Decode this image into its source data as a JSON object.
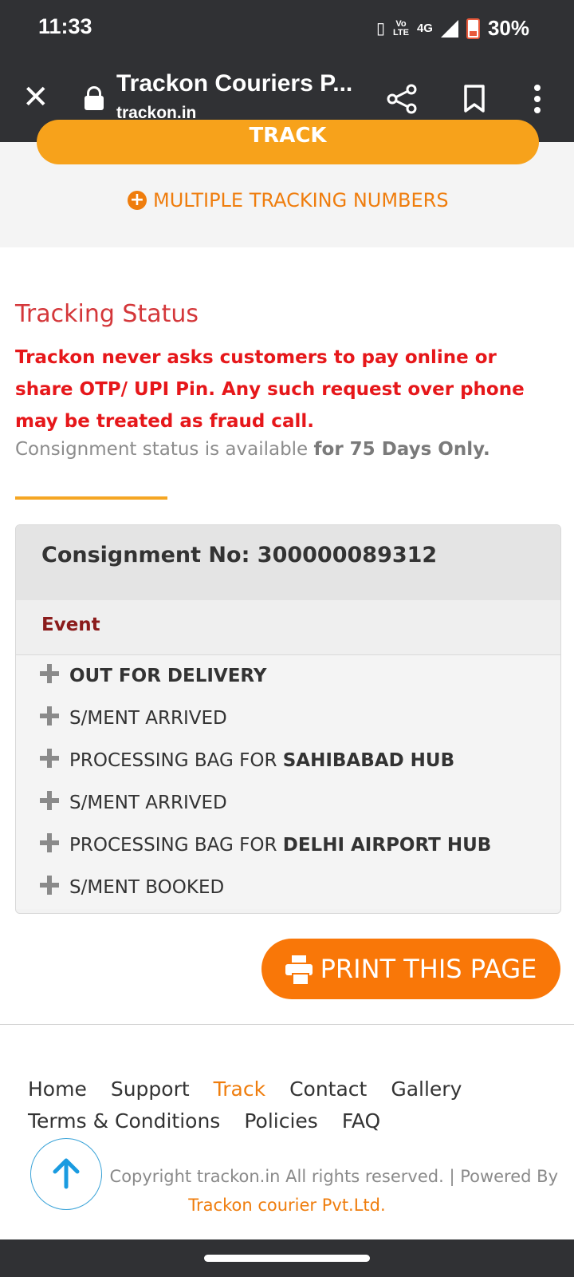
{
  "status_bar": {
    "time": "11:33",
    "network": "4G",
    "volte": "Vo LTE",
    "battery": "30%"
  },
  "browser": {
    "page_title": "Trackon Couriers P...",
    "url": "trackon.in"
  },
  "track_button": "TRACK",
  "multiple_tracking": "MULTIPLE TRACKING NUMBERS",
  "tracking": {
    "title": "Tracking Status",
    "warning": "Trackon never asks customers to pay online or share OTP/ UPI Pin. Any such request over phone may be treated as fraud call.",
    "availability_prefix": "Consignment status is available ",
    "availability_bold": "for 75 Days Only."
  },
  "consignment": {
    "label": "Consignment No: 300000089312",
    "event_header": "Event",
    "events": [
      {
        "text": "",
        "bold": "OUT FOR DELIVERY"
      },
      {
        "text": "S/MENT ARRIVED",
        "bold": ""
      },
      {
        "text": "PROCESSING BAG FOR ",
        "bold": "SAHIBABAD HUB"
      },
      {
        "text": "S/MENT ARRIVED",
        "bold": ""
      },
      {
        "text": "PROCESSING BAG FOR ",
        "bold": "DELHI AIRPORT HUB"
      },
      {
        "text": "S/MENT BOOKED",
        "bold": ""
      }
    ]
  },
  "print_button": "PRINT THIS PAGE",
  "footer": {
    "nav": [
      "Home",
      "Support",
      "Track",
      "Contact",
      "Gallery"
    ],
    "nav2": [
      "Terms & Conditions",
      "Policies",
      "FAQ"
    ],
    "active": "Track",
    "copyright": "© Copyright trackon.in All rights reserved.   |   Powered By",
    "powered_by": "Trackon courier Pvt.Ltd."
  },
  "colors": {
    "accent": "#ef7d0d",
    "warning_red": "#e6171a",
    "title_red": "#d4373a",
    "browser_bar": "#303134"
  }
}
